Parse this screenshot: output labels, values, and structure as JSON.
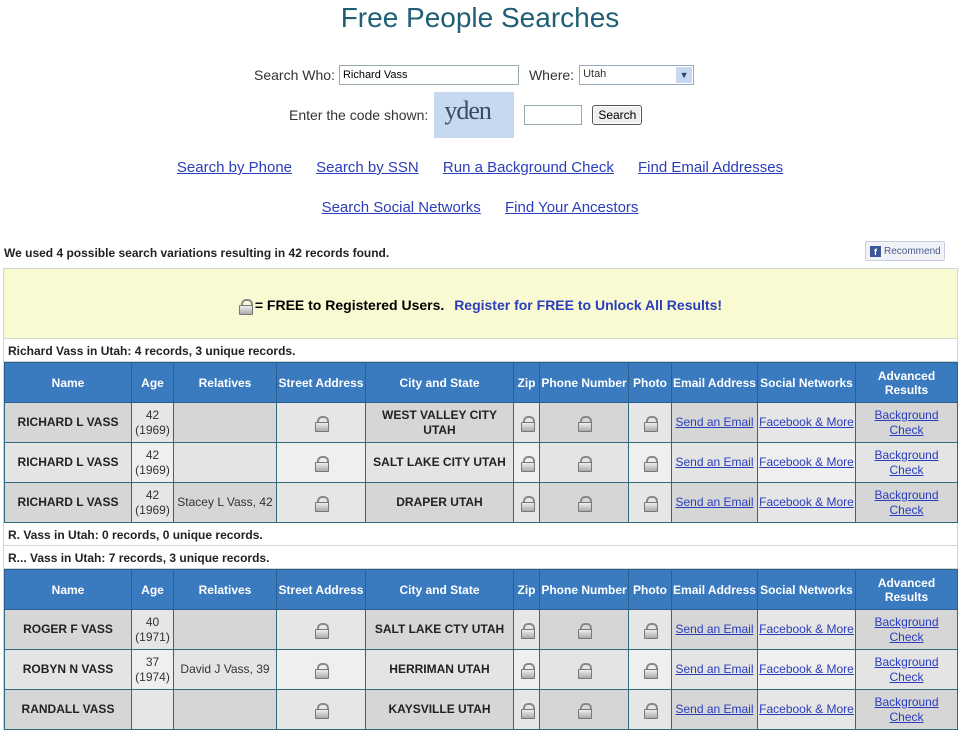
{
  "page_title": "Free People Searches",
  "search": {
    "who_label": "Search Who:",
    "who_value": "Richard Vass",
    "where_label": "Where:",
    "where_value": "Utah",
    "code_label": "Enter the code shown:",
    "captcha_text": "yden",
    "code_value": "",
    "search_button": "Search"
  },
  "links_row1": [
    "Search by Phone",
    "Search by SSN",
    "Run a Background Check",
    "Find Email Addresses"
  ],
  "links_row2": [
    "Search Social Networks",
    "Find Your Ancestors"
  ],
  "info_text": "We used 4 possible search variations resulting in 42 records found.",
  "recommend_label": "Recommend",
  "promo": {
    "text": "= FREE to Registered Users.",
    "link": "Register for FREE to Unlock All Results!"
  },
  "columns": [
    "Name",
    "Age",
    "Relatives",
    "Street Address",
    "City and State",
    "Zip",
    "Phone Number",
    "Photo",
    "Email Address",
    "Social Networks",
    "Advanced Results"
  ],
  "link_labels": {
    "email": "Send an Email",
    "social": "Facebook & More",
    "advanced": "Background Check"
  },
  "sections": [
    {
      "label": "Richard Vass in Utah: 4 records, 3 unique records.",
      "rows": [
        {
          "name": "RICHARD L VASS",
          "age": "42",
          "year": "(1969)",
          "relatives": "",
          "city": "WEST VALLEY CITY UTAH"
        },
        {
          "name": "RICHARD L VASS",
          "age": "42",
          "year": "(1969)",
          "relatives": "",
          "city": "SALT LAKE CITY UTAH"
        },
        {
          "name": "RICHARD L VASS",
          "age": "42",
          "year": "(1969)",
          "relatives": "Stacey L Vass, 42",
          "city": "DRAPER UTAH"
        }
      ]
    },
    {
      "label": "R. Vass in Utah: 0 records, 0 unique records.",
      "rows": []
    },
    {
      "label": "R... Vass in Utah: 7 records, 3 unique records.",
      "rows": [
        {
          "name": "ROGER F VASS",
          "age": "40",
          "year": "(1971)",
          "relatives": "",
          "city": "SALT LAKE CTY UTAH"
        },
        {
          "name": "ROBYN N VASS",
          "age": "37",
          "year": "(1974)",
          "relatives": "David J Vass, 39",
          "city": "HERRIMAN UTAH"
        },
        {
          "name": "RANDALL VASS",
          "age": "",
          "year": "",
          "relatives": "",
          "city": "KAYSVILLE UTAH"
        }
      ]
    }
  ]
}
